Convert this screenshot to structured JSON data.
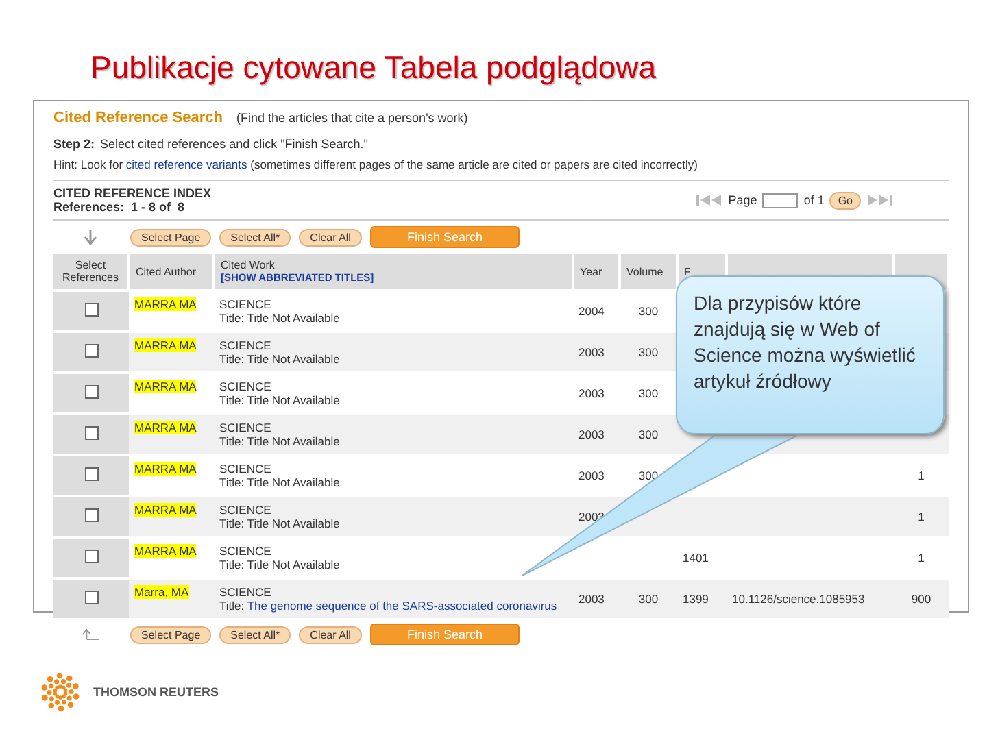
{
  "slide_title": "Publikacje cytowane Tabela podglądowa",
  "screen": {
    "heading": "Cited Reference Search",
    "heading_note": "(Find the articles that cite a person's work)",
    "step_label": "Step 2:",
    "step_text": "Select cited references and click \"Finish Search.\"",
    "hint_before": "Hint: Look for",
    "hint_link": "cited reference variants",
    "hint_after": "(sometimes different pages of the same article are cited or papers are cited incorrectly)",
    "index_title": "CITED REFERENCE INDEX",
    "references_label": "References:",
    "references_range": "1 - 8 of",
    "references_total": "8",
    "pager": {
      "page_label": "Page",
      "of_label": "of 1",
      "go": "Go"
    },
    "top_buttons": [
      {
        "label": "Select Page",
        "kind": "secondary"
      },
      {
        "label": "Select All*",
        "kind": "secondary"
      },
      {
        "label": "Clear All",
        "kind": "secondary"
      },
      {
        "label": "Finish Search",
        "kind": "primary"
      }
    ],
    "bottom_buttons": [
      {
        "label": "Select Page",
        "kind": "secondary"
      },
      {
        "label": "Select All*",
        "kind": "secondary"
      },
      {
        "label": "Clear All",
        "kind": "secondary"
      },
      {
        "label": "Finish Search",
        "kind": "primary"
      }
    ],
    "table": {
      "columns": [
        {
          "label": "Select References"
        },
        {
          "label": "Cited Author"
        },
        {
          "label": "Cited Work",
          "link": "[SHOW ABBREVIATED TITLES]"
        },
        {
          "label": "Year"
        },
        {
          "label": "Volume"
        },
        {
          "label": "F"
        }
      ],
      "rows": [
        {
          "checked": false,
          "author": "MARRA MA",
          "journal": "SCIENCE",
          "title_label": "Title:",
          "title": "Title Not Available",
          "year": "2004",
          "volume": "300"
        },
        {
          "checked": false,
          "author": "MARRA MA",
          "journal": "SCIENCE",
          "title_label": "Title:",
          "title": "Title Not Available",
          "year": "2003",
          "volume": "300"
        },
        {
          "checked": false,
          "author": "MARRA MA",
          "journal": "SCIENCE",
          "title_label": "Title:",
          "title": "Title Not Available",
          "year": "2003",
          "volume": "300"
        },
        {
          "checked": false,
          "author": "MARRA MA",
          "journal": "SCIENCE",
          "title_label": "Title:",
          "title": "Title Not Available",
          "year": "2003",
          "volume": "300"
        },
        {
          "checked": false,
          "author": "MARRA MA",
          "journal": "SCIENCE",
          "title_label": "Title:",
          "title": "Title Not Available",
          "year": "2003",
          "volume": "300",
          "count": "1"
        },
        {
          "checked": false,
          "author": "MARRA MA",
          "journal": "SCIENCE",
          "title_label": "Title:",
          "title": "Title Not Available",
          "year": "2003",
          "count": "1"
        },
        {
          "checked": false,
          "author": "MARRA MA",
          "journal": "SCIENCE",
          "title_label": "Title:",
          "title": "Title Not Available",
          "page": "1401",
          "count": "1"
        },
        {
          "checked": false,
          "author": "Marra, MA",
          "journal": "SCIENCE",
          "title_label": "Title:",
          "title_link": "The genome sequence of the SARS-associated coronavirus",
          "year": "2003",
          "volume": "300",
          "page": "1399",
          "doi": "10.1126/science.1085953",
          "count": "900"
        }
      ]
    }
  },
  "callout": {
    "text": "Dla przypisów które znajdują się w Web of Science można wyświetlić artykuł źródłowy"
  },
  "logo": {
    "text": "THOMSON REUTERS"
  }
}
